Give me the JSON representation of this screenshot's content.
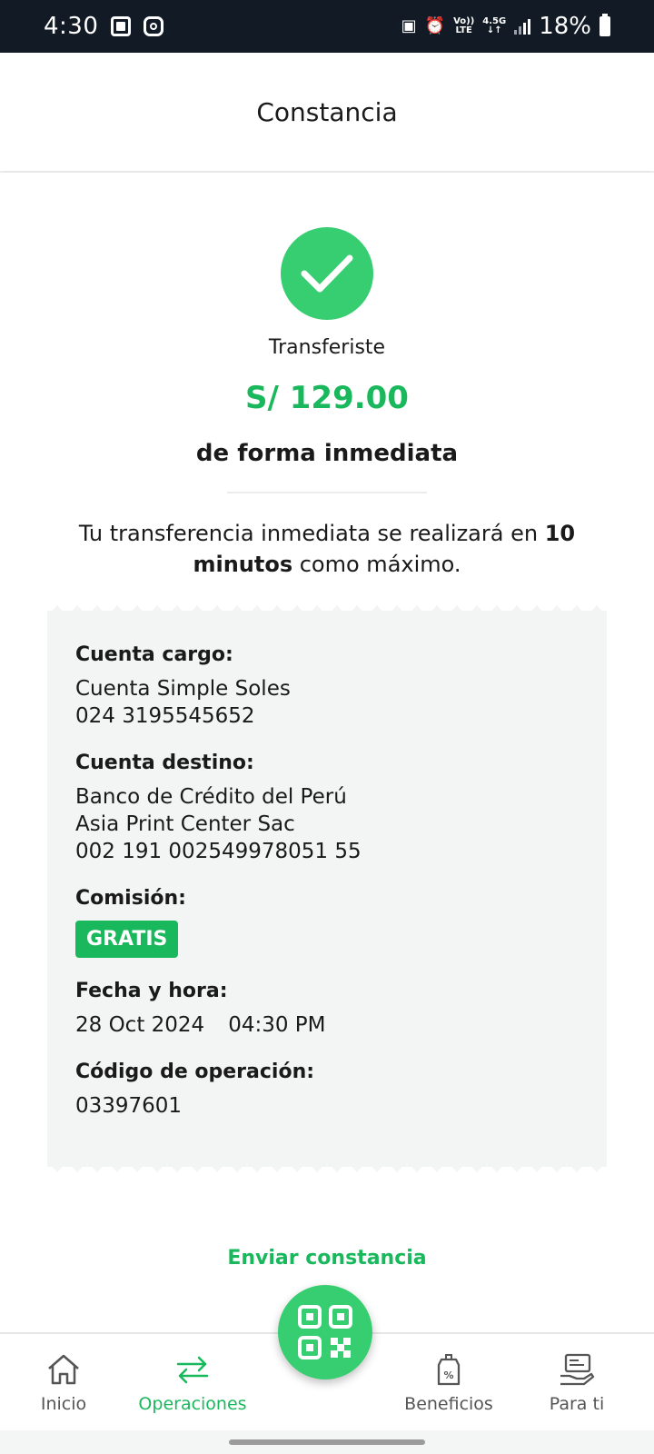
{
  "status_bar": {
    "time": "4:30",
    "net_top": "Vo))",
    "net_bottom": "LTE",
    "gen_top": "4.5G",
    "gen_bottom": "↓↑",
    "battery": "18%"
  },
  "header": {
    "title": "Constancia"
  },
  "result": {
    "lead": "Transferiste",
    "amount": "S/ 129.00",
    "subtitle": "de forma inmediata",
    "msg_part1": "Tu transferencia inmediata se realizará en ",
    "msg_bold": "10 minutos",
    "msg_part2": " como máximo."
  },
  "receipt": {
    "cuenta_cargo_label": "Cuenta cargo:",
    "cuenta_cargo_name": "Cuenta Simple Soles",
    "cuenta_cargo_number": "024 3195545652",
    "cuenta_destino_label": "Cuenta destino:",
    "cuenta_destino_bank": "Banco de Crédito del Perú",
    "cuenta_destino_name": "Asia Print Center Sac",
    "cuenta_destino_number": "002 191 002549978051 55",
    "comision_label": "Comisión:",
    "comision_badge": "GRATIS",
    "fecha_label": "Fecha y hora:",
    "fecha_date": "28 Oct 2024",
    "fecha_time": "04:30 PM",
    "codigo_label": "Código de operación:",
    "codigo_value": "03397601"
  },
  "actions": {
    "send": "Enviar constancia"
  },
  "nav": {
    "items": [
      {
        "label": "Inicio",
        "icon": "home-icon"
      },
      {
        "label": "Operaciones",
        "icon": "transfer-arrows-icon"
      },
      {
        "label": "Beneficios",
        "icon": "discount-tag-icon"
      },
      {
        "label": "Para ti",
        "icon": "card-hand-icon"
      }
    ],
    "fab_icon": "qr-code-icon"
  },
  "colors": {
    "accent": "#1ab85c",
    "success_circle": "#37cd71",
    "status_bar": "#121b25"
  }
}
